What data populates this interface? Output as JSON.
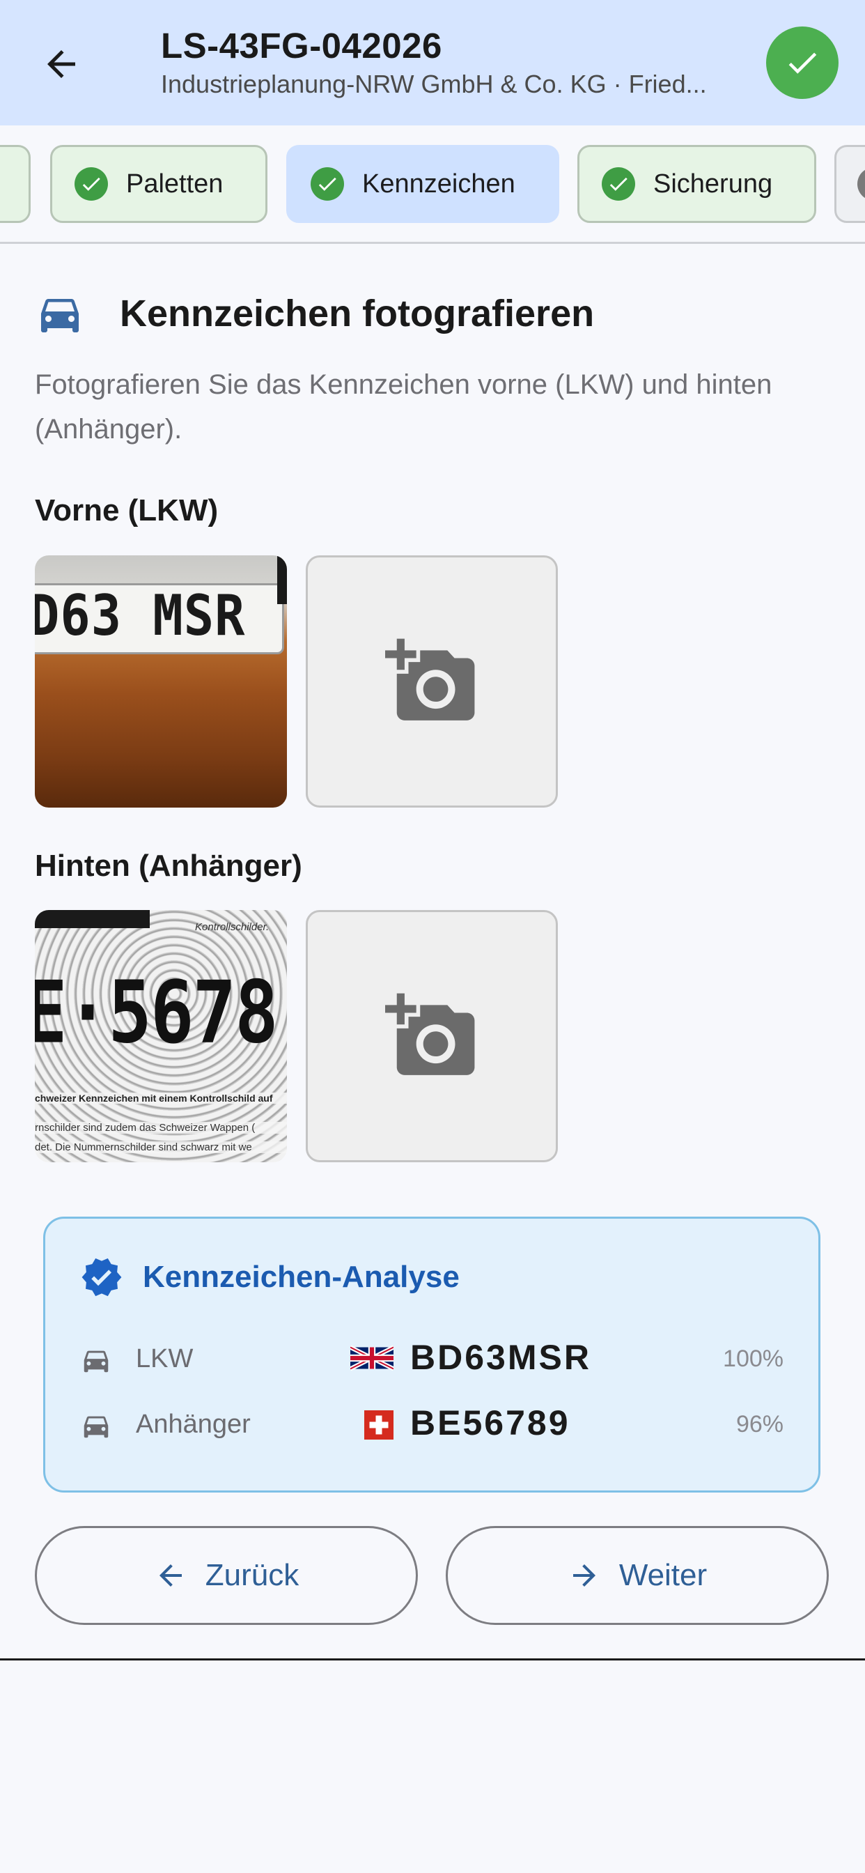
{
  "header": {
    "title": "LS-43FG-042026",
    "subtitle": "Industrieplanung-NRW GmbH & Co. KG · Fried..."
  },
  "tabs": [
    {
      "label": "",
      "state": "done"
    },
    {
      "label": "Paletten",
      "state": "done"
    },
    {
      "label": "Kennzeichen",
      "state": "active"
    },
    {
      "label": "Sicherung",
      "state": "done"
    },
    {
      "label": "",
      "state": "partial"
    }
  ],
  "section": {
    "title": "Kennzeichen fotografieren",
    "description": "Fotografieren Sie das Kennzeichen vorne (LKW) und hinten (Anhänger)."
  },
  "front": {
    "label": "Vorne (LKW)",
    "photo_text": "D63 MSR"
  },
  "rear": {
    "label": "Hinten (Anhänger)",
    "photo_text": "E·5678",
    "photo_caption_top": "Kontrollschilder.",
    "photo_caption_1": "chweizer Kennzeichen mit einem Kontrollschild auf",
    "photo_caption_2": "rnschilder sind zudem das Schweizer Wappen (",
    "photo_caption_3": "det. Die Nummernschilder sind schwarz mit we"
  },
  "analysis": {
    "title": "Kennzeichen-Analyse",
    "rows": [
      {
        "label": "LKW",
        "flag": "uk-flag",
        "plate": "BD63MSR",
        "confidence": "100%"
      },
      {
        "label": "Anhänger",
        "flag": "swiss-flag",
        "plate": "BE56789",
        "confidence": "96%"
      }
    ]
  },
  "buttons": {
    "back": "Zurück",
    "next": "Weiter"
  },
  "colors": {
    "header_bg": "#d6e5ff",
    "success": "#4caf50",
    "accent_blue": "#1b5bb0",
    "analysis_bg": "#e3f1fc"
  }
}
